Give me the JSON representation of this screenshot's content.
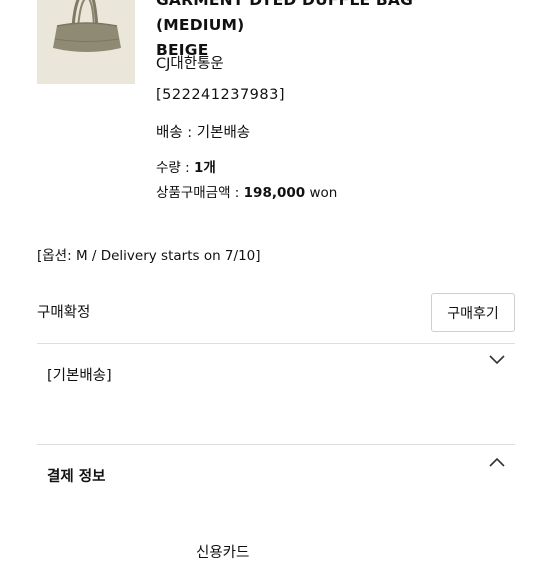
{
  "order": {
    "product_title": "GARMENT DYED DUFFLE BAG (MEDIUM)\nBEIGE",
    "courier": "CJ대한통운",
    "tracking_number": "[522241237983]",
    "shipping_method": "배송 : 기본배송",
    "quantity_label": "수량 : ",
    "quantity_value": "1개",
    "price_label": "상품구매금액 : ",
    "price_value": "198,000",
    "price_unit": " won",
    "options": "[옵션: M / Delivery starts on 7/10]",
    "product_image": "beige-duffle-bag-thumbnail"
  },
  "purchase": {
    "confirm_label": "구매확정",
    "review_button": "구매후기"
  },
  "sections": [
    {
      "label": "[기본배송]",
      "state": "collapsed",
      "icon": "chevron-down-icon"
    },
    {
      "label": "결제 정보",
      "state": "expanded",
      "icon": "chevron-up-icon"
    }
  ],
  "payment": {
    "cutoff_text": "신용카드"
  },
  "colors": {
    "divider": "#dedede",
    "bag": "#8f8a73",
    "thumb_bg": "#ebe6da"
  }
}
